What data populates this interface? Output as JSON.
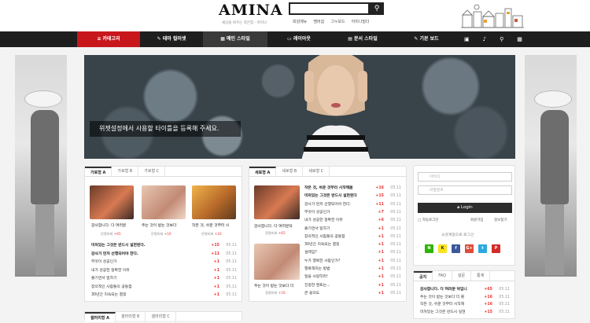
{
  "header": {
    "logo": "AMINA",
    "tagline": "세상을 바꾸는 작은힘 - 아미나",
    "links": [
      "회원메뉴",
      "멤버쉽",
      "그누보드",
      "아미나빌더"
    ]
  },
  "nav": {
    "items": [
      "카테고리",
      "테마 컬러셋",
      "메인 스타일",
      "레이아웃",
      "문서 스타일",
      "기본 보드"
    ]
  },
  "hero": {
    "caption": "위젯설정에서 사용할 타이틀을 등록해 주세요."
  },
  "left_box": {
    "tabs": [
      "가로형 A",
      "가로형 B",
      "가로형 C"
    ],
    "cards": [
      {
        "title": "감사합니다. 다 여러분",
        "author": "안명미회",
        "count": "+65"
      },
      {
        "title": "주는 것이 받는 것보다",
        "author": "안명미회",
        "count": "+16"
      },
      {
        "title": "작은 것, 쉬운 것부터 시",
        "author": "안명미회",
        "count": "+16"
      }
    ],
    "list": [
      {
        "text": "미처있는 그것은 반드시 실현된다.",
        "count": "+15",
        "date": "05.11",
        "bold": true
      },
      {
        "text": "감사가 먼저 선행되어야 한다.",
        "count": "+11",
        "date": "05.11",
        "bold": true
      },
      {
        "text": "무엇이 성공인가",
        "count": "+1",
        "date": "05.11",
        "bold": false
      },
      {
        "text": "내가 성공한 정확한 이유",
        "count": "+1",
        "date": "05.11",
        "bold": false
      },
      {
        "text": "즐기면서 일하기",
        "count": "+1",
        "date": "05.11",
        "bold": false
      },
      {
        "text": "창의적인 사람들의 공통점",
        "count": "+1",
        "date": "05.11",
        "bold": false
      },
      {
        "text": "30년간 지속되는 결정",
        "count": "+1",
        "date": "05.11",
        "bold": false
      }
    ]
  },
  "mid_box": {
    "tabs": [
      "세로형 A",
      "세로형 B",
      "세로형 C"
    ],
    "cards": [
      {
        "title": "감사합니다. 다 여러분덕",
        "author": "정명미회",
        "count": "+65"
      },
      {
        "title": "주는 것이 받는 것보다 더",
        "author": "정명미회",
        "count": "+16"
      }
    ],
    "list": [
      {
        "text": "작은 것, 쉬운 것부터 시작해봄",
        "count": "+16",
        "date": "05.11",
        "bold": true
      },
      {
        "text": "미처있는 그것은 반드시 실현된다",
        "count": "+15",
        "date": "05.11",
        "bold": true
      },
      {
        "text": "감사가 먼저 선행되어야 한다.",
        "count": "+11",
        "date": "05.11",
        "bold": false
      },
      {
        "text": "무엇이 성공인가",
        "count": "+7",
        "date": "05.11",
        "bold": false
      },
      {
        "text": "내가 성공한 정확한 이유",
        "count": "+6",
        "date": "05.11",
        "bold": false
      },
      {
        "text": "즐기면서 일하기",
        "count": "+1",
        "date": "05.11",
        "bold": false
      },
      {
        "text": "창의적인 사람들의 공통점",
        "count": "+1",
        "date": "05.11",
        "bold": false
      },
      {
        "text": "30년간 지속되는 결정",
        "count": "+1",
        "date": "05.11",
        "bold": false
      },
      {
        "text": "설레임?",
        "count": "+1",
        "date": "05.11",
        "bold": false
      },
      {
        "text": "누가 행복한 사람인가?",
        "count": "+1",
        "date": "05.11",
        "bold": false
      },
      {
        "text": "행복해지는 방법",
        "count": "+1",
        "date": "05.11",
        "bold": false
      },
      {
        "text": "일을 사랑하라!",
        "count": "+1",
        "date": "05.11",
        "bold": false
      },
      {
        "text": "진정한 멘토는...",
        "count": "+1",
        "date": "05.11",
        "bold": false
      },
      {
        "text": "큰 용의도",
        "count": "+1",
        "date": "05.11",
        "bold": false
      }
    ]
  },
  "login": {
    "id_placeholder": "아이디",
    "pw_placeholder": "비밀번호",
    "button": "Login",
    "remember": "자동로그인",
    "join": "회원가입",
    "find": "정보찾기",
    "social": "소셜계정으로 로그인",
    "sns": [
      "N",
      "K",
      "f",
      "G+",
      "t",
      "P"
    ]
  },
  "notice": {
    "tabs": [
      "공지",
      "FAQ",
      "설문",
      "통계"
    ],
    "items": [
      {
        "text": "감사합니다. 다 여러분 덕입니",
        "count": "+65",
        "date": "05.11",
        "bold": true
      },
      {
        "text": "주는 것이 받는 것보다 더 를",
        "count": "+16",
        "date": "05.11",
        "bold": false
      },
      {
        "text": "작은 것, 쉬운 것부터 시작해",
        "count": "+16",
        "date": "05.11",
        "bold": false
      },
      {
        "text": "미처있는 그것은 반드시 실현",
        "count": "+15",
        "date": "05.11",
        "bold": false
      }
    ]
  },
  "bottom_tabs": [
    "갤러리형 A",
    "갤러리형 B",
    "갤러리형 C"
  ],
  "colors": {
    "accent": "#c8161d",
    "nav_bg": "#1e1e1e"
  }
}
